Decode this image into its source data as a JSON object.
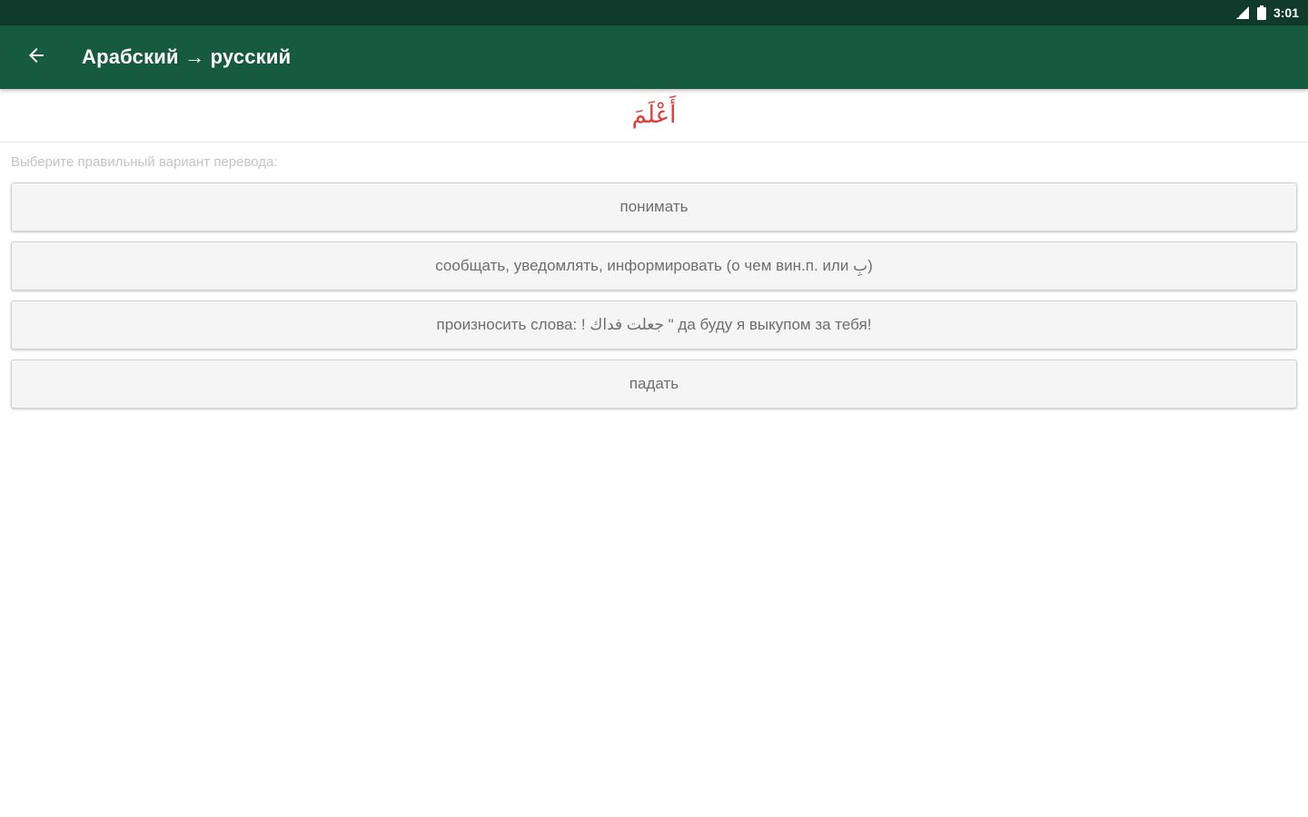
{
  "status_bar": {
    "time": "3:01",
    "icons": [
      "signal-icon",
      "battery-icon"
    ]
  },
  "app_bar": {
    "back_icon": "arrow-back-icon",
    "title": "Арабский → русский"
  },
  "question": {
    "word": "أَعْلَمَ",
    "word_color": "#e53935"
  },
  "hint": "Выберите правильный вариант перевода:",
  "options": [
    {
      "label": "понимать"
    },
    {
      "label": "сообщать, уведомлять, информировать (о чем вин.п. или بِ)"
    },
    {
      "label": "произносить слова: ! جعلت فداك \" да буду я выкупом за тебя!"
    },
    {
      "label": "падать"
    }
  ],
  "colors": {
    "status_bar": "#103a2b",
    "app_bar": "#165a3f",
    "option_bg": "#f5f5f5",
    "option_text": "#6e6e6e",
    "hint_text": "#c4c4c4"
  }
}
